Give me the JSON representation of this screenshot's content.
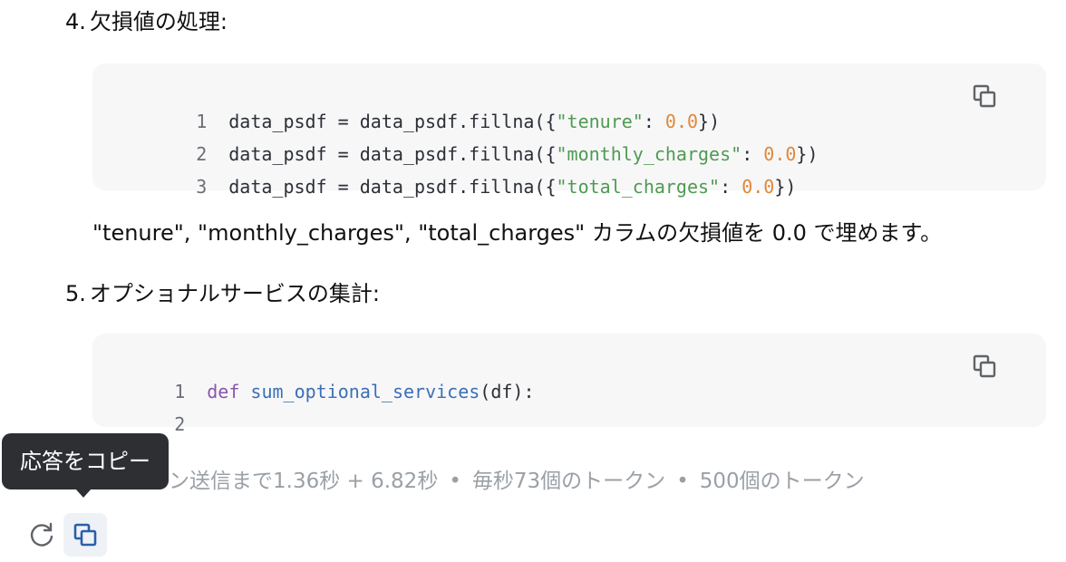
{
  "section4": {
    "number": "4.",
    "title": "欠損値の処理:",
    "code_lines": [
      {
        "ln": "1",
        "pre": "data_psdf = data_psdf.fillna({",
        "key": "\"tenure\"",
        "mid": ": ",
        "val": "0.0",
        "post": "})"
      },
      {
        "ln": "2",
        "pre": "data_psdf = data_psdf.fillna({",
        "key": "\"monthly_charges\"",
        "mid": ": ",
        "val": "0.0",
        "post": "})"
      },
      {
        "ln": "3",
        "pre": "data_psdf = data_psdf.fillna({",
        "key": "\"total_charges\"",
        "mid": ": ",
        "val": "0.0",
        "post": "})"
      }
    ],
    "description": "\"tenure\", \"monthly_charges\", \"total_charges\" カラムの欠損値を 0.0 で埋めます。"
  },
  "section5": {
    "number": "5.",
    "title": "オプショナルサービスの集計:",
    "code_lines": [
      {
        "ln": "1",
        "kw": "def",
        "fn": "sum_optional_services",
        "rest": "(df):"
      },
      {
        "ln": "2"
      }
    ]
  },
  "stats": {
    "first_token": "ン送信まで1.36秒 + 6.82秒",
    "separator": "•",
    "rate": "毎秒73個のトークン",
    "count": "500個のトークン"
  },
  "tooltip": {
    "label": "応答をコピー"
  },
  "actions": {
    "regenerate_icon": "refresh-icon",
    "copy_icon": "copy-icon"
  },
  "colors": {
    "code_bg": "#f7f7f8",
    "string": "#4f9a52",
    "number": "#e0883a",
    "keyword": "#8a56ac",
    "function": "#3b6fb6",
    "tooltip_bg": "#2d2f33"
  }
}
